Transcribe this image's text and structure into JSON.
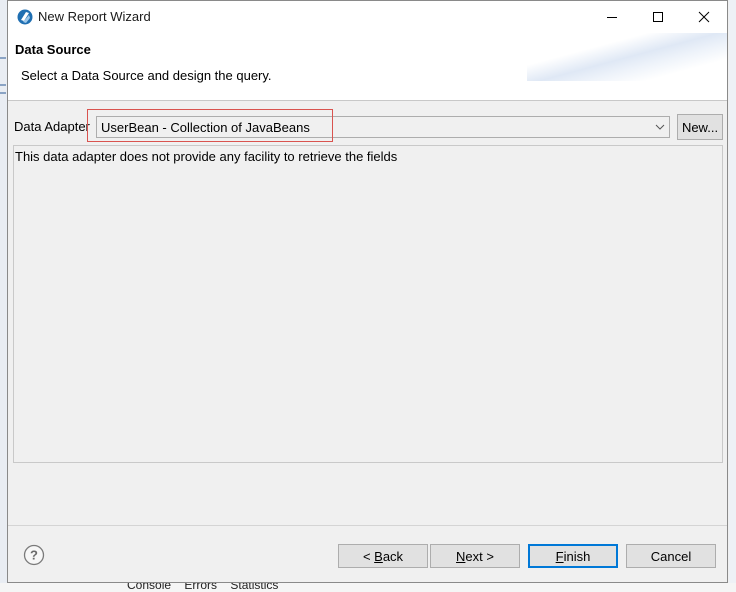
{
  "window": {
    "title": "New Report Wizard"
  },
  "header": {
    "title": "Data Source",
    "description": "Select a Data Source and design the query."
  },
  "adapter": {
    "label": "Data Adapter",
    "selected": "UserBean - Collection of JavaBeans",
    "new_button": "New..."
  },
  "fields": {
    "message": "This data adapter does not provide any facility to retrieve the fields"
  },
  "buttons": {
    "back": {
      "prefix": "< ",
      "mnemonic": "B",
      "rest": "ack"
    },
    "next": {
      "mnemonic": "N",
      "rest": "ext >"
    },
    "finish": {
      "mnemonic": "F",
      "rest": "inish"
    },
    "cancel": "Cancel"
  },
  "background": {
    "tabs": [
      "Console",
      "Errors",
      "Statistics"
    ]
  },
  "icons": {
    "app": "app-logo-icon",
    "help": "help-icon",
    "dropdown": "chevron-down-icon"
  },
  "colors": {
    "highlight": "#d9534f",
    "default_button_border": "#0078d7"
  }
}
